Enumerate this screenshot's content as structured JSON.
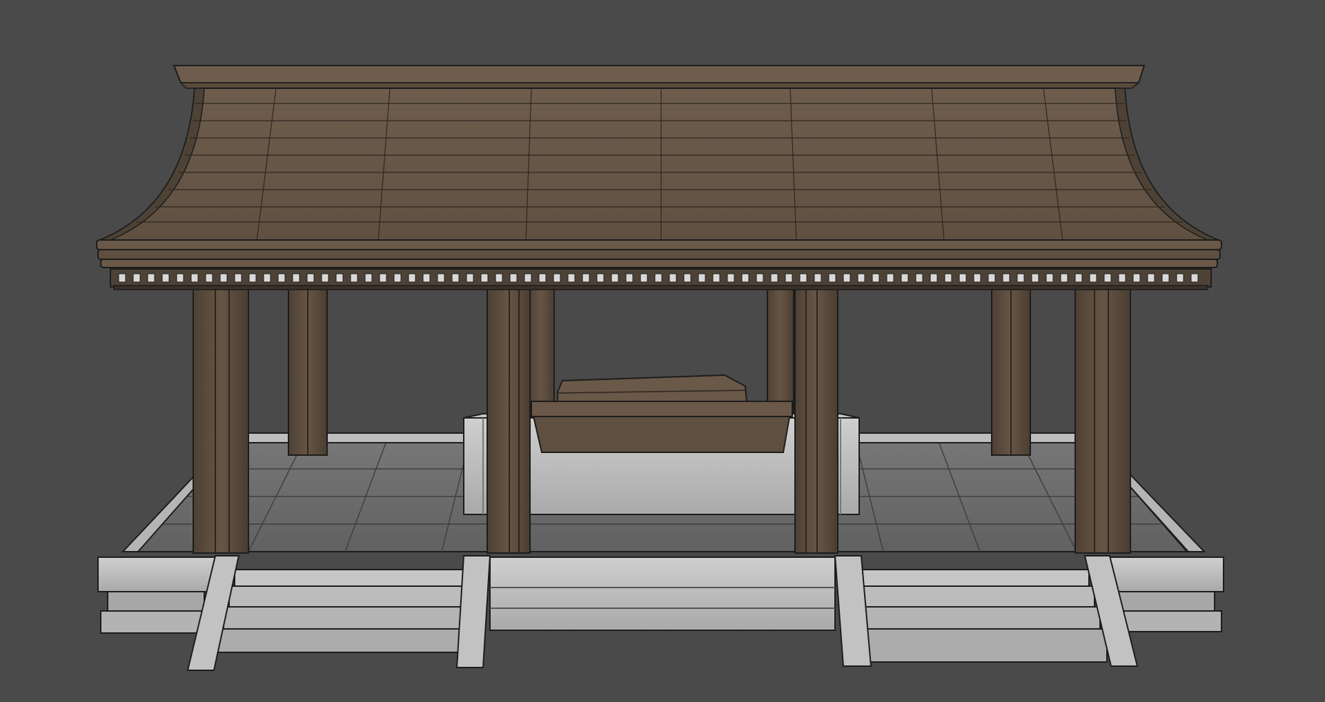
{
  "scene": {
    "subject": "pavilion-3d-model",
    "colors": {
      "background": "#4a4a4a",
      "roof": "#6b5a4a",
      "roof_dark": "#4e4236",
      "pillar": "#5e4e3f",
      "pillar_dark": "#3a3028",
      "floor": "#6f6f6f",
      "floor_dark": "#5a5a5a",
      "stone": "#bdbdbd",
      "stone_dark": "#9a9a9a",
      "edge": "#1c1c1c",
      "dentil": "#d8d8d8"
    }
  }
}
